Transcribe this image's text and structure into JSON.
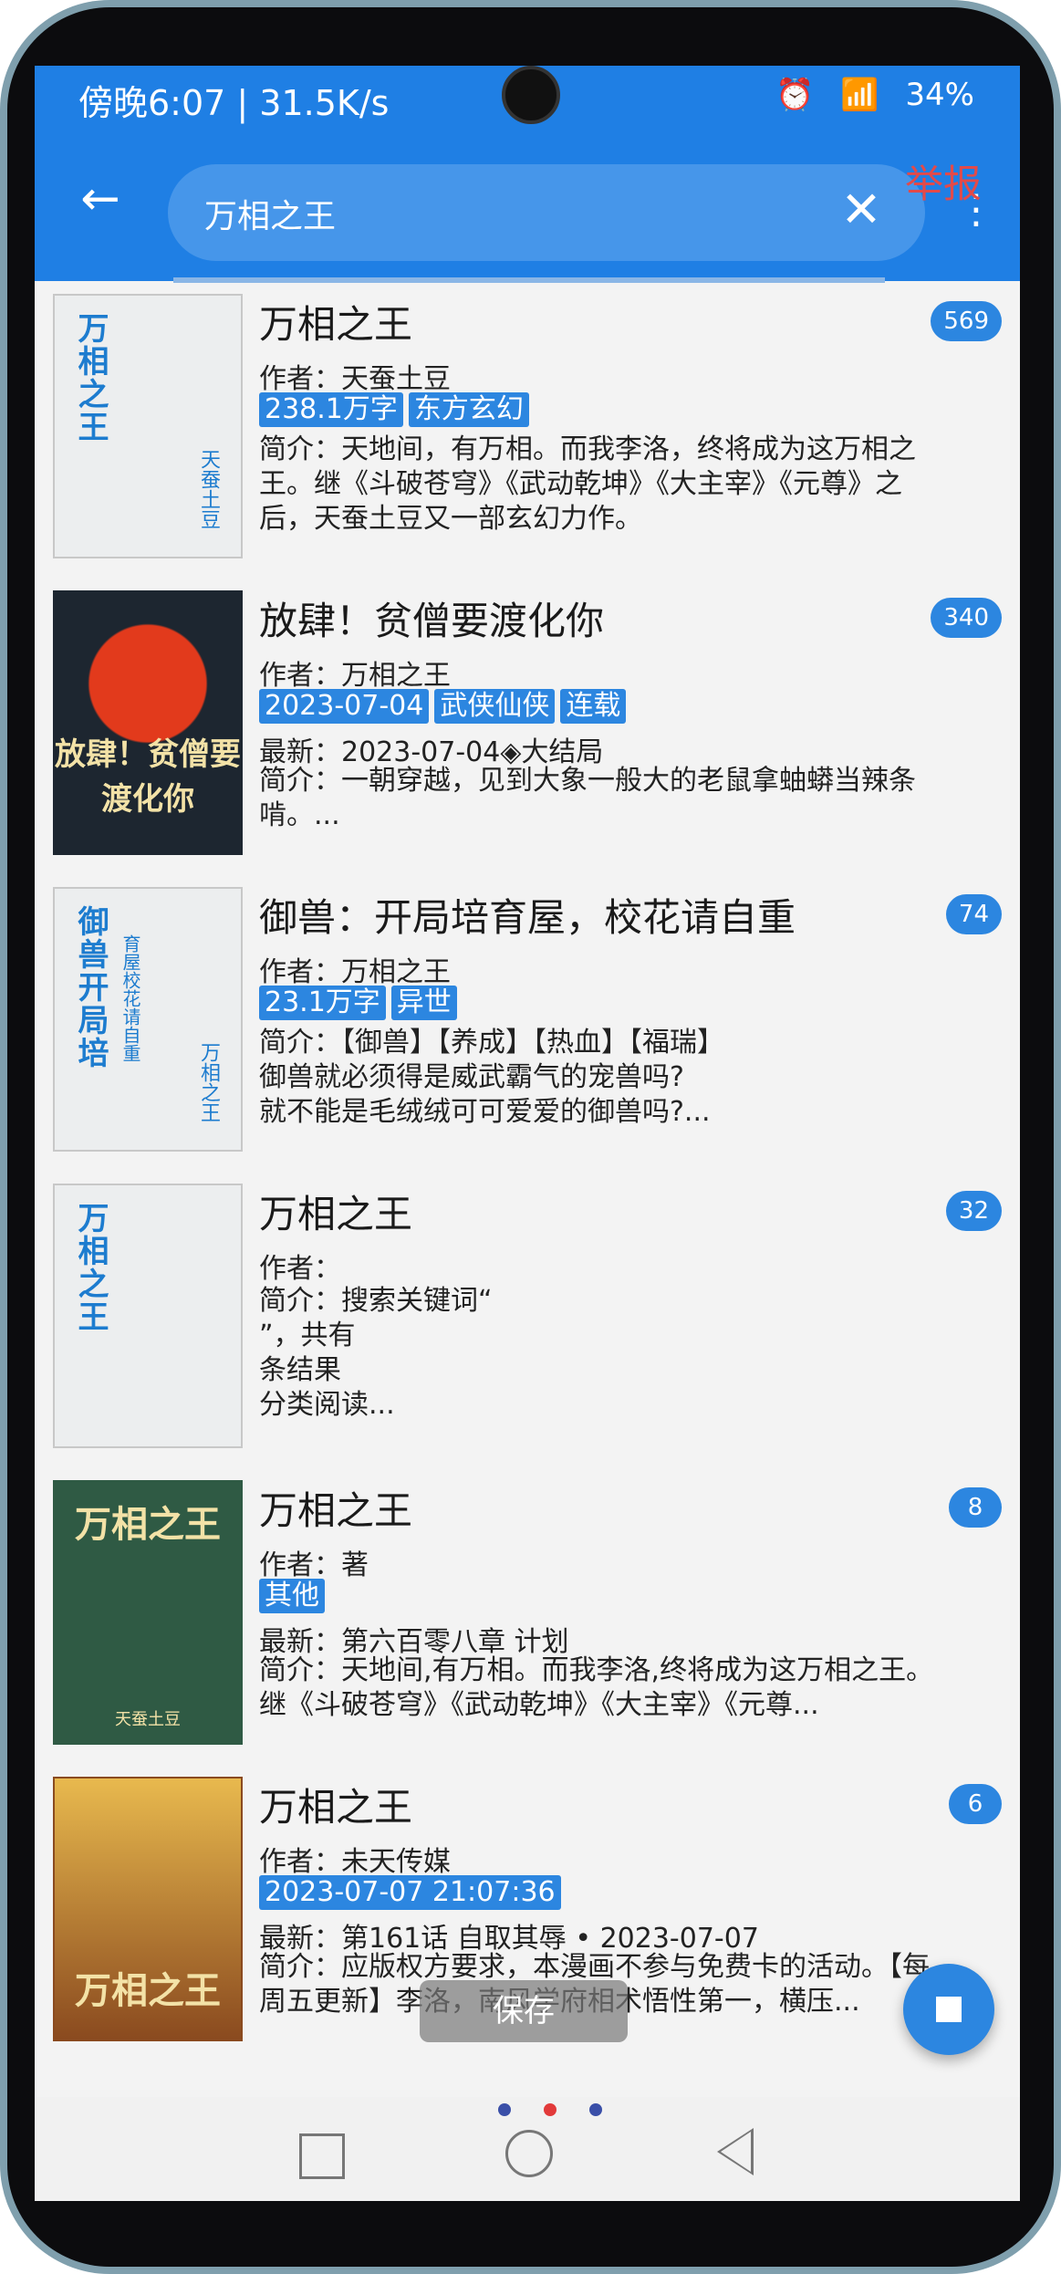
{
  "status_bar": {
    "left_text": "傍晚6:07 | 31.5K/s",
    "right_text": "34%"
  },
  "header": {
    "search_value": "万相之王",
    "report_label": "举报"
  },
  "results": [
    {
      "title": "万相之王",
      "author": "作者：天蚕土豆",
      "tags": [
        "238.1万字",
        "东方玄幻"
      ],
      "latest": "",
      "intro": "简介：天地间，有万相。而我李洛，终将成为这万相之王。继《斗破苍穹》《武动乾坤》《大主宰》《元尊》之后，天蚕土豆又一部玄幻力作。",
      "count": "569",
      "cover_title": "万相之王",
      "cover_author": "天蚕土豆"
    },
    {
      "title": "放肆！贫僧要渡化你",
      "author": "作者：万相之王",
      "tags": [
        "2023-07-04",
        "武侠仙侠",
        "连载"
      ],
      "latest": "最新：2023-07-04◈大结局",
      "intro": "简介：一朝穿越，见到大象一般大的老鼠拿蚰蟒当辣条啃。...",
      "count": "340",
      "cover_title": "放肆！贫僧要渡化你",
      "cover_author": ""
    },
    {
      "title": "御兽：开局培育屋，校花请自重",
      "author": "作者：万相之王",
      "tags": [
        "23.1万字",
        "异世"
      ],
      "latest": "",
      "intro": "简介：【御兽】【养成】【热血】【福瑞】\n御兽就必须得是威武霸气的宠兽吗?\n就不能是毛绒绒可可爱爱的御兽吗?...",
      "count": "74",
      "cover_title": "御兽开局培",
      "cover_sub": "育屋校花请自重",
      "cover_author": "万相之王"
    },
    {
      "title": "万相之王",
      "author": "作者：",
      "tags": [],
      "latest": "",
      "intro": "简介：搜索关键词“\n”，共有\n条结果\n分类阅读...",
      "count": "32",
      "cover_title": "万相之王",
      "cover_author": ""
    },
    {
      "title": "万相之王",
      "author": "作者：著",
      "tags": [
        "其他"
      ],
      "latest": "最新：第六百零八章 计划",
      "intro": "简介：天地间,有万相。而我李洛,终将成为这万相之王。继《斗破苍穹》《武动乾坤》《大主宰》《元尊...",
      "count": "8",
      "cover_title": "万相之王",
      "cover_author": "天蚕土豆"
    },
    {
      "title": "万相之王",
      "author": "作者：未天传媒",
      "tags": [
        "2023-07-07 21:07:36"
      ],
      "latest": "最新：第161话 自取其辱 • 2023-07-07",
      "intro": "简介：应版权方要求，本漫画不参与免费卡的活动。【每周五更新】李洛，南风学府相术悟性第一，横压...",
      "count": "6",
      "cover_title": "万相之王",
      "cover_author": ""
    }
  ],
  "toast": "保存",
  "colors": {
    "primary": "#1f7fe4",
    "tag": "#2c86e0",
    "report": "#e24a4a"
  },
  "icons": {
    "back": "arrow-left-icon",
    "clear": "close-icon",
    "more": "more-vert-icon",
    "fab": "stop-icon"
  }
}
